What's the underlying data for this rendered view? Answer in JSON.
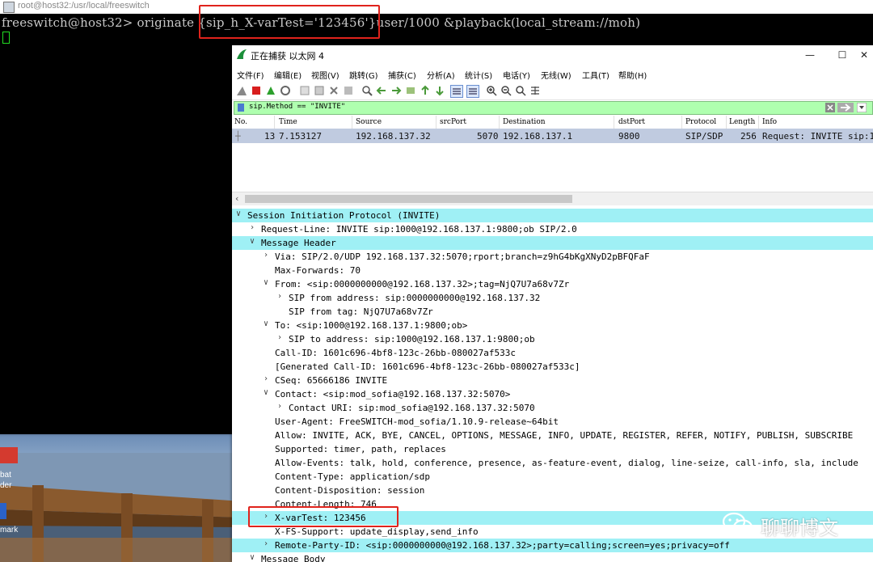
{
  "terminal": {
    "window_title": "root@host32:/usr/local/freeswitch",
    "prompt": "freeswitch@host32>",
    "command_prefix": "originate ",
    "command_highlight": "{sip_h_X-varTest='123456'}",
    "command_suffix": "user/1000 &playback(local_stream://moh)"
  },
  "desktop": {
    "label1": "bat",
    "label2": "der",
    "label3": "mark"
  },
  "wireshark": {
    "title": "正在捕获 以太网 4",
    "menu": [
      "文件(F)",
      "编辑(E)",
      "视图(V)",
      "跳转(G)",
      "捕获(C)",
      "分析(A)",
      "统计(S)",
      "电话(Y)",
      "无线(W)",
      "工具(T)",
      "帮助(H)"
    ],
    "filter": "sip.Method == \"INVITE\"",
    "columns": [
      "No.",
      "Time",
      "Source",
      "srcPort",
      "Destination",
      "dstPort",
      "Protocol",
      "Length",
      "Info"
    ],
    "packet": {
      "no": "13",
      "time": "7.153127",
      "source": "192.168.137.32",
      "src_port": "5070",
      "destination": "192.168.137.1",
      "dst_port": "9800",
      "protocol": "SIP/SDP",
      "length": "256",
      "info": "Request: INVITE sip:1"
    },
    "details": [
      {
        "text": "Session Initiation Protocol (INVITE)",
        "arrow": "v",
        "indent": 0,
        "selected": true
      },
      {
        "text": "Request-Line: INVITE sip:1000@192.168.137.1:9800;ob SIP/2.0",
        "arrow": ">",
        "indent": 1,
        "selected": false
      },
      {
        "text": "Message Header",
        "arrow": "v",
        "indent": 1,
        "selected": true
      },
      {
        "text": "Via: SIP/2.0/UDP 192.168.137.32:5070;rport;branch=z9hG4bKgXNyD2pBFQFaF",
        "arrow": ">",
        "indent": 2,
        "selected": false
      },
      {
        "text": "Max-Forwards: 70",
        "arrow": "",
        "indent": 2,
        "selected": false
      },
      {
        "text": "From: <sip:0000000000@192.168.137.32>;tag=NjQ7U7a68v7Zr",
        "arrow": "v",
        "indent": 2,
        "selected": false
      },
      {
        "text": "SIP from address: sip:0000000000@192.168.137.32",
        "arrow": ">",
        "indent": 3,
        "selected": false
      },
      {
        "text": "SIP from tag: NjQ7U7a68v7Zr",
        "arrow": "",
        "indent": 3,
        "selected": false
      },
      {
        "text": "To: <sip:1000@192.168.137.1:9800;ob>",
        "arrow": "v",
        "indent": 2,
        "selected": false
      },
      {
        "text": "SIP to address: sip:1000@192.168.137.1:9800;ob",
        "arrow": ">",
        "indent": 3,
        "selected": false
      },
      {
        "text": "Call-ID: 1601c696-4bf8-123c-26bb-080027af533c",
        "arrow": "",
        "indent": 2,
        "selected": false
      },
      {
        "text": "[Generated Call-ID: 1601c696-4bf8-123c-26bb-080027af533c]",
        "arrow": "",
        "indent": 2,
        "selected": false
      },
      {
        "text": "CSeq: 65666186 INVITE",
        "arrow": ">",
        "indent": 2,
        "selected": false
      },
      {
        "text": "Contact: <sip:mod_sofia@192.168.137.32:5070>",
        "arrow": "v",
        "indent": 2,
        "selected": false
      },
      {
        "text": "Contact URI: sip:mod_sofia@192.168.137.32:5070",
        "arrow": ">",
        "indent": 3,
        "selected": false
      },
      {
        "text": "User-Agent: FreeSWITCH-mod_sofia/1.10.9-release~64bit",
        "arrow": "",
        "indent": 2,
        "selected": false
      },
      {
        "text": "Allow: INVITE, ACK, BYE, CANCEL, OPTIONS, MESSAGE, INFO, UPDATE, REGISTER, REFER, NOTIFY, PUBLISH, SUBSCRIBE",
        "arrow": "",
        "indent": 2,
        "selected": false
      },
      {
        "text": "Supported: timer, path, replaces",
        "arrow": "",
        "indent": 2,
        "selected": false
      },
      {
        "text": "Allow-Events: talk, hold, conference, presence, as-feature-event, dialog, line-seize, call-info, sla, include",
        "arrow": "",
        "indent": 2,
        "selected": false
      },
      {
        "text": "Content-Type: application/sdp",
        "arrow": "",
        "indent": 2,
        "selected": false
      },
      {
        "text": "Content-Disposition: session",
        "arrow": "",
        "indent": 2,
        "selected": false
      },
      {
        "text": "Content-Length: 746",
        "arrow": "",
        "indent": 2,
        "selected": false
      },
      {
        "text": "X-varTest: 123456",
        "arrow": ">",
        "indent": 2,
        "selected": true
      },
      {
        "text": "X-FS-Support: update_display,send_info",
        "arrow": "",
        "indent": 2,
        "selected": false
      },
      {
        "text": "Remote-Party-ID: <sip:0000000000@192.168.137.32>;party=calling;screen=yes;privacy=off",
        "arrow": ">",
        "indent": 2,
        "selected": true
      },
      {
        "text": "Message Body",
        "arrow": "v",
        "indent": 1,
        "selected": false
      }
    ]
  },
  "watermark": "聊聊博文",
  "colors": {
    "highlight_box": "#e0231c",
    "selected_row": "#9ff0f5",
    "packet_row": "#c0cbe0",
    "filter_bg": "#afffaf"
  }
}
